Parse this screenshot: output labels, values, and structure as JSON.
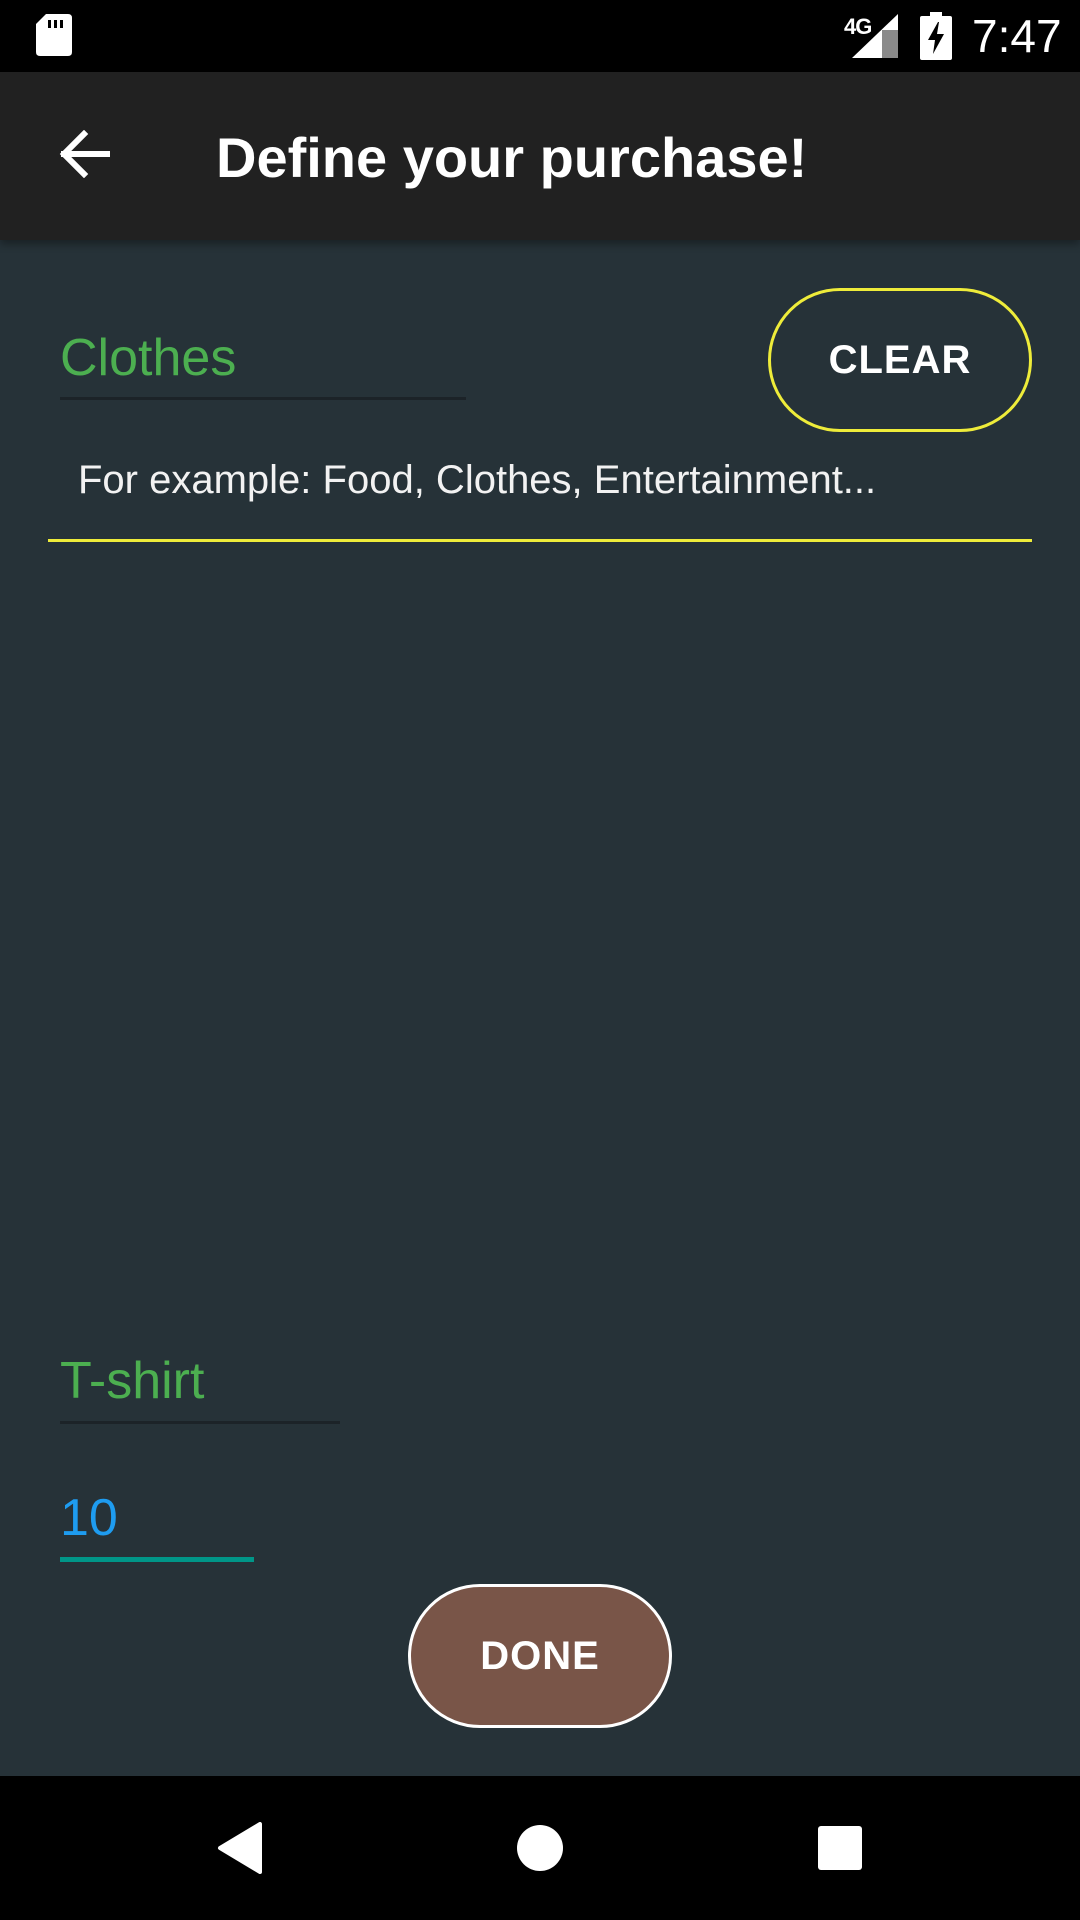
{
  "status_bar": {
    "time": "7:47",
    "network_type": "4G",
    "icons": [
      "sd-card-icon",
      "signal-icon",
      "battery-charging-icon"
    ]
  },
  "app_bar": {
    "title": "Define your purchase!",
    "back_icon": "arrow-back-icon"
  },
  "form": {
    "category_value": "Clothes",
    "clear_label": "CLEAR",
    "category_hint": "For example: Food, Clothes, Entertainment...",
    "item_value": "T-shirt",
    "price_value": "10",
    "done_label": "DONE"
  },
  "nav_bar": {
    "icons": [
      "nav-back-icon",
      "nav-home-icon",
      "nav-recents-icon"
    ]
  },
  "colors": {
    "background": "#263238",
    "app_bar": "#212121",
    "input_text": "#4caf50",
    "price_text": "#1e9cf0",
    "accent_outline": "#eeec3a",
    "price_underline": "#009688",
    "done_button": "#795548"
  }
}
